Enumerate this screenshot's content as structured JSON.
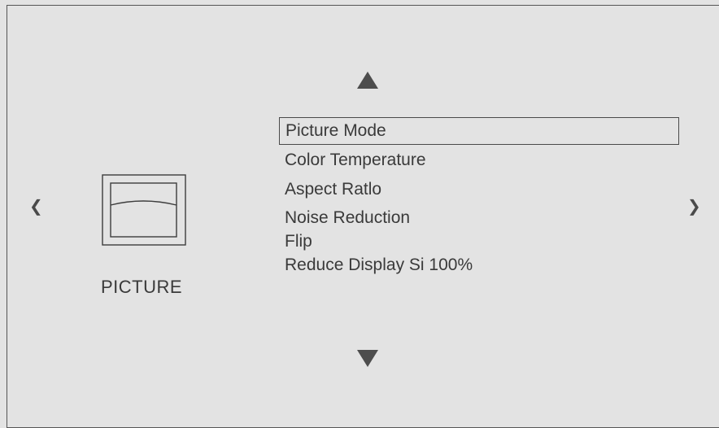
{
  "category": {
    "label": "PICTURE",
    "icon": "picture-monitor-icon"
  },
  "navigation": {
    "up_icon": "arrow-up-icon",
    "down_icon": "arrow-down-icon",
    "left_glyph": "❮",
    "right_glyph": "❯"
  },
  "menu": {
    "selected_index": 0,
    "items": [
      {
        "label": "Picture Mode"
      },
      {
        "label": "Color Temperature"
      },
      {
        "label": "Aspect Ratlo"
      },
      {
        "label": "Noise Reduction"
      },
      {
        "label": "Flip"
      },
      {
        "label": "Reduce Display Si  100%"
      }
    ]
  },
  "colors": {
    "background": "#e3e3e3",
    "text": "#3a3a3a",
    "accent": "#4d4d4d"
  }
}
